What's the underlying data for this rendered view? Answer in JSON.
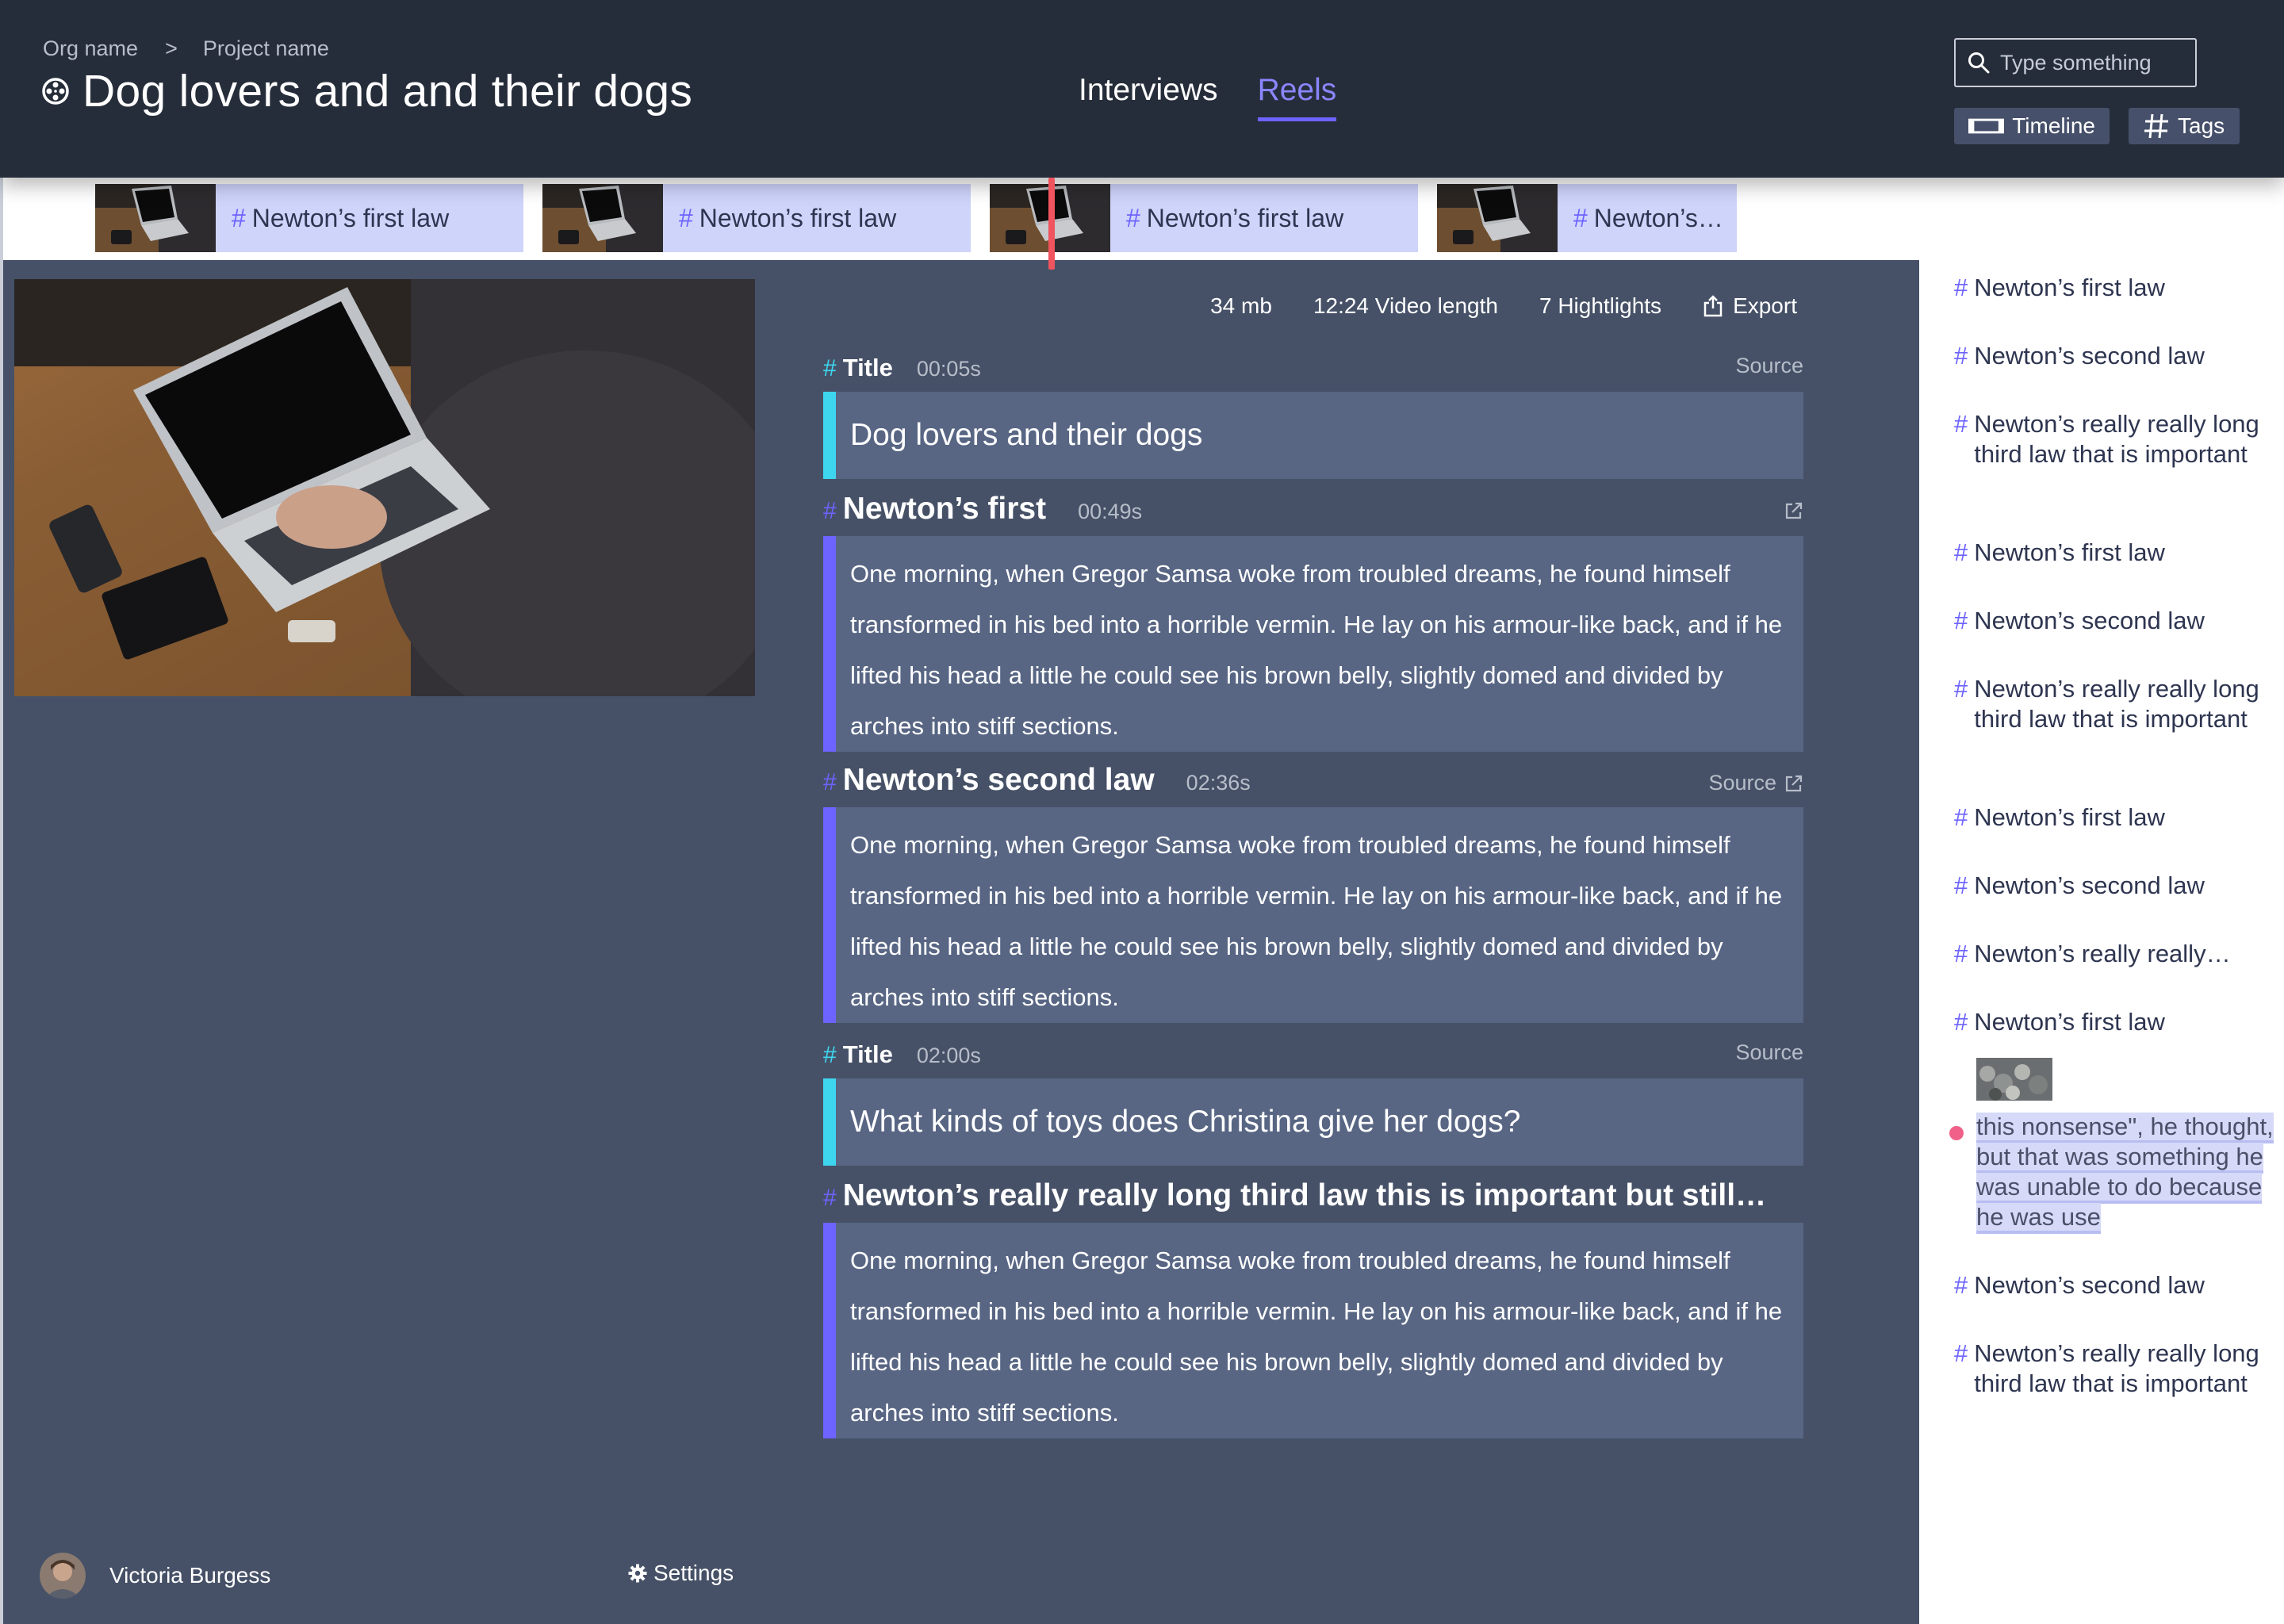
{
  "header": {
    "breadcrumb": {
      "org": "Org name",
      "separator": ">",
      "project": "Project name"
    },
    "title": "Dog lovers and and their dogs",
    "nav_tabs": [
      {
        "label": "Interviews",
        "active": false
      },
      {
        "label": "Reels",
        "active": true
      }
    ],
    "search": {
      "placeholder": "Type something",
      "value": ""
    },
    "buttons": {
      "timeline": "Timeline",
      "tags": "Tags"
    }
  },
  "clip_strip": {
    "clips": [
      {
        "label": "Newton’s first law"
      },
      {
        "label": "Newton’s first law"
      },
      {
        "label": "Newton’s first law"
      },
      {
        "label": "Newton’s…"
      }
    ],
    "hash": "#"
  },
  "stats": {
    "size": "34 mb",
    "video_length": "12:24 Video length",
    "highlights": "7 Hightlights",
    "export_label": "Export"
  },
  "sections": [
    {
      "kind": "title",
      "heading": "Title",
      "time": "00:05s",
      "source": "Source",
      "text": "Dog lovers and their dogs",
      "bar_color": "#3ed6ef"
    },
    {
      "kind": "highlight",
      "heading": "Newton’s first",
      "time": "00:49s",
      "source": "",
      "text": "One morning, when Gregor Samsa woke from troubled dreams, he found himself transformed in his bed into a horrible vermin. He lay on his armour-like back, and if he lifted his head a little he could see his brown belly, slightly domed and divided by arches into stiff sections.",
      "bar_color": "#6d63ff"
    },
    {
      "kind": "highlight",
      "heading": "Newton’s second law",
      "time": "02:36s",
      "source": "Source",
      "text": "One morning, when Gregor Samsa woke from troubled dreams, he found himself transformed in his bed into a horrible vermin. He lay on his armour-like back, and if he lifted his head a little he could see his brown belly, slightly domed and divided by arches into stiff sections.",
      "bar_color": "#6d63ff"
    },
    {
      "kind": "title",
      "heading": "Title",
      "time": "02:00s",
      "source": "Source",
      "text": "What kinds of toys does Christina give her dogs?",
      "bar_color": "#3ed6ef"
    },
    {
      "kind": "highlight",
      "heading": "Newton’s really really long third law this is important but still…",
      "time": "",
      "source": "",
      "text": "One morning, when Gregor Samsa woke from troubled dreams, he found himself transformed in his bed into a horrible vermin. He lay on his armour-like back, and if he lifted his head a little he could see his brown belly, slightly domed and divided by arches into stiff sections.",
      "bar_color": "#6d63ff"
    }
  ],
  "user": {
    "name": "Victoria Burgess"
  },
  "settings_label": "Settings",
  "sidebar": {
    "tags": [
      "Newton’s first law",
      "Newton’s second law",
      "Newton’s really really long third law that is important",
      "Newton’s first law",
      "Newton’s second law",
      "Newton’s really really long third law that is important",
      "Newton’s first law",
      "Newton’s second law",
      "Newton’s really really…",
      "Newton’s first law",
      "Newton’s second law",
      "Newton’s really really long third law that is important"
    ],
    "highlight_text": "this nonsense\", he thought, but that was something he was unable to do because he was use"
  },
  "colors": {
    "header_bg": "#262d3a",
    "main_bg": "#465167",
    "card_bg": "#586684",
    "accent": "#6d63ff",
    "title_bar": "#3ed6ef",
    "clip_bg": "#cfd4fb",
    "playhead": "#f0545e",
    "highlight_dot": "#f06088"
  },
  "icons": {
    "reel": "film-reel-icon",
    "search": "search-icon",
    "timeline": "timeline-icon",
    "tags": "hashtag-icon",
    "export": "export-icon",
    "source": "external-link-icon",
    "settings": "gear-icon"
  }
}
